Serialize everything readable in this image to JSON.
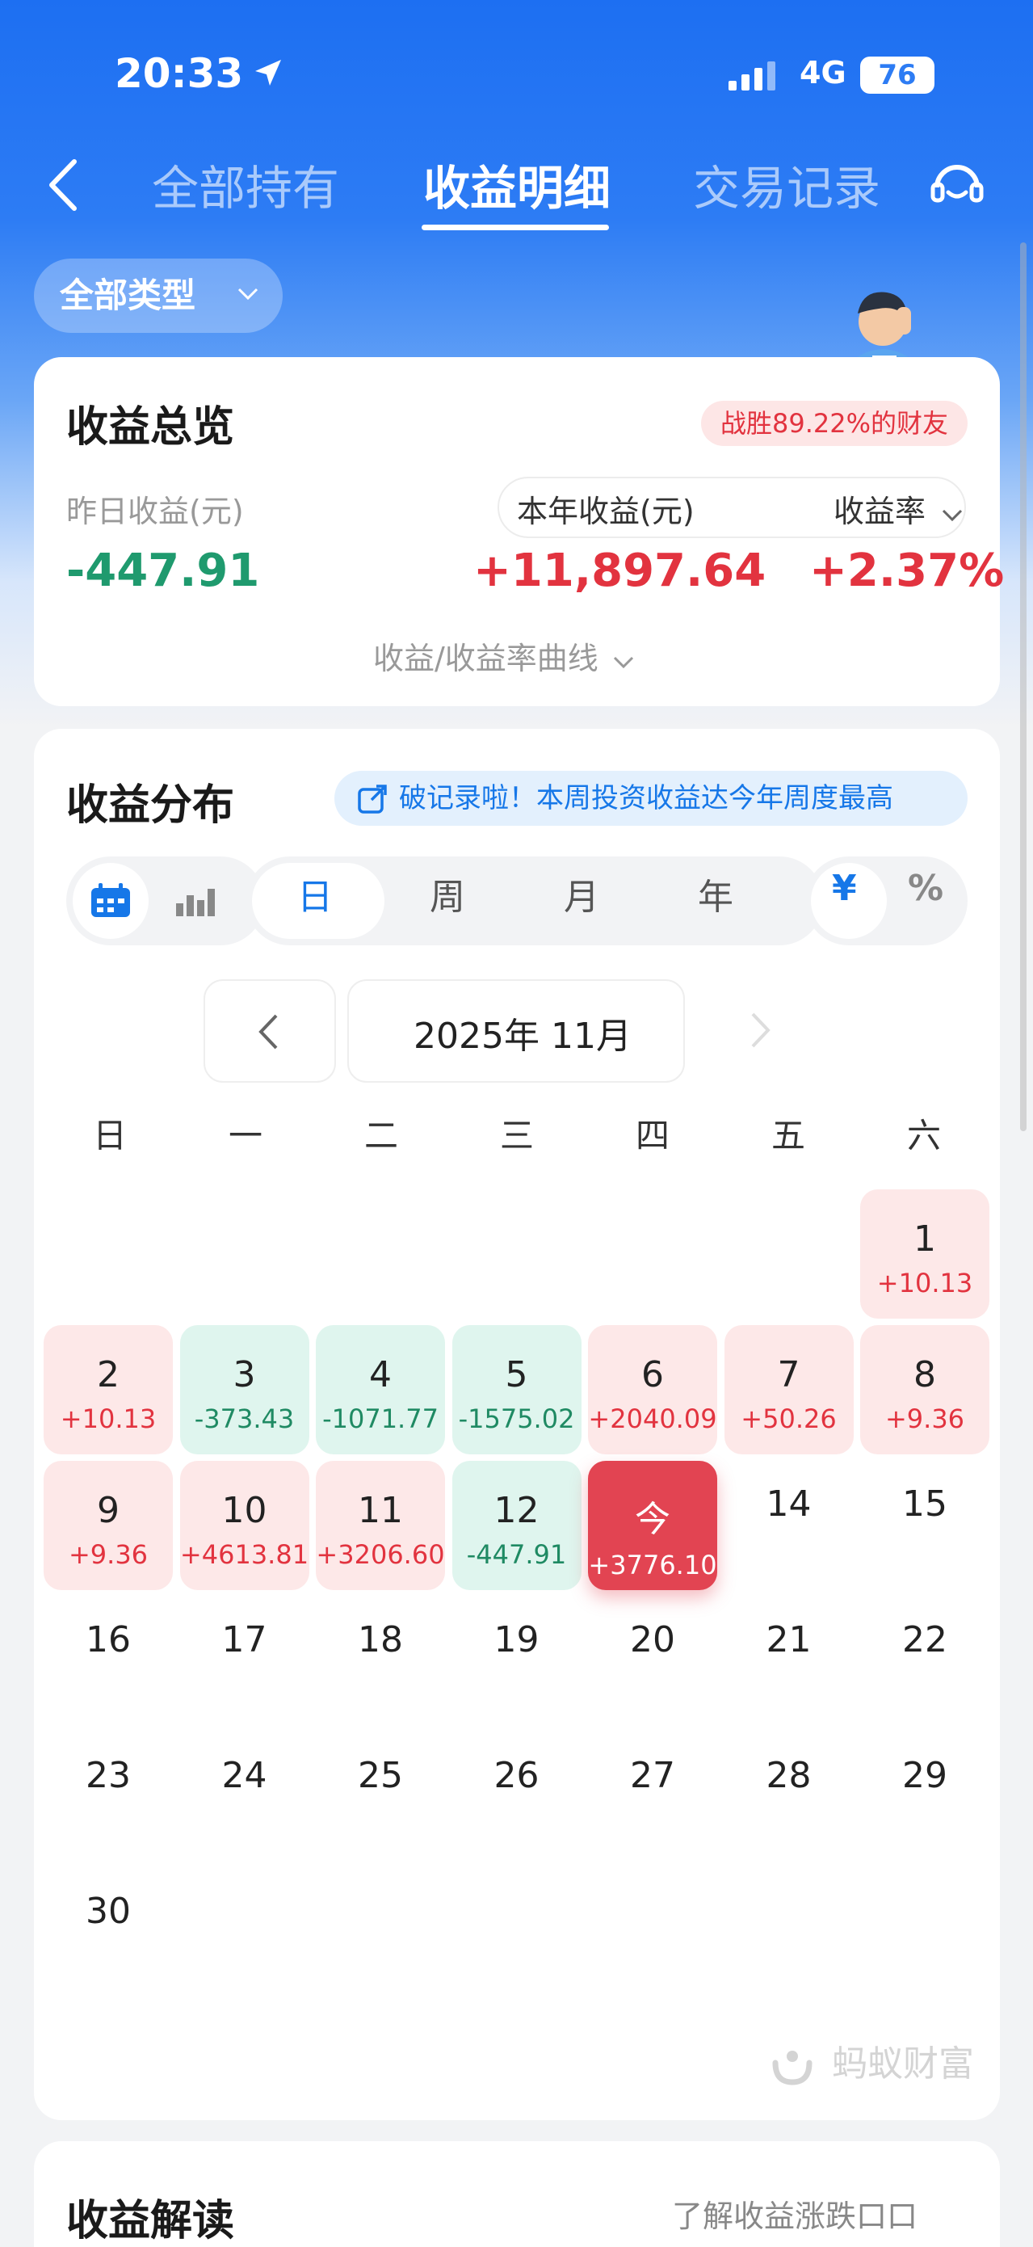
{
  "status_bar": {
    "time": "20:33",
    "network": "4G",
    "battery": "76"
  },
  "header": {
    "tabs": [
      {
        "label": "全部持有",
        "active": false
      },
      {
        "label": "收益明细",
        "active": true
      },
      {
        "label": "交易记录",
        "active": false
      }
    ]
  },
  "filter": {
    "type_label": "全部类型"
  },
  "overview": {
    "title": "收益总览",
    "rank_badge": "战胜89.22%的财友",
    "yesterday_label": "昨日收益(元)",
    "yesterday_value": "-447.91",
    "year_label": "本年收益(元)",
    "year_value": "+11,897.64",
    "rate_label": "收益率",
    "rate_value": "+2.37%",
    "curve_link": "收益/收益率曲线"
  },
  "distribution": {
    "title": "收益分布",
    "banner": "破记录啦！本周投资收益达今年周度最高",
    "periods": [
      "日",
      "周",
      "月",
      "年"
    ],
    "units": [
      "¥",
      "%"
    ],
    "month_label": "2025年 11月",
    "weekdays": [
      "日",
      "一",
      "二",
      "三",
      "四",
      "五",
      "六"
    ],
    "days": [
      {
        "day": "1",
        "value": "+10.13",
        "state": "pos"
      },
      {
        "day": "2",
        "value": "+10.13",
        "state": "pos"
      },
      {
        "day": "3",
        "value": "-373.43",
        "state": "neg"
      },
      {
        "day": "4",
        "value": "-1071.77",
        "state": "neg"
      },
      {
        "day": "5",
        "value": "-1575.02",
        "state": "neg"
      },
      {
        "day": "6",
        "value": "+2040.09",
        "state": "pos"
      },
      {
        "day": "7",
        "value": "+50.26",
        "state": "pos"
      },
      {
        "day": "8",
        "value": "+9.36",
        "state": "pos"
      },
      {
        "day": "9",
        "value": "+9.36",
        "state": "pos"
      },
      {
        "day": "10",
        "value": "+4613.81",
        "state": "pos"
      },
      {
        "day": "11",
        "value": "+3206.60",
        "state": "pos"
      },
      {
        "day": "12",
        "value": "-447.91",
        "state": "neg"
      },
      {
        "day": "今",
        "value": "+3776.10",
        "state": "today"
      },
      {
        "day": "14",
        "value": "",
        "state": "plain"
      },
      {
        "day": "15",
        "value": "",
        "state": "plain"
      },
      {
        "day": "16",
        "value": "",
        "state": "plain"
      },
      {
        "day": "17",
        "value": "",
        "state": "plain"
      },
      {
        "day": "18",
        "value": "",
        "state": "plain"
      },
      {
        "day": "19",
        "value": "",
        "state": "plain"
      },
      {
        "day": "20",
        "value": "",
        "state": "plain"
      },
      {
        "day": "21",
        "value": "",
        "state": "plain"
      },
      {
        "day": "22",
        "value": "",
        "state": "plain"
      },
      {
        "day": "23",
        "value": "",
        "state": "plain"
      },
      {
        "day": "24",
        "value": "",
        "state": "plain"
      },
      {
        "day": "25",
        "value": "",
        "state": "plain"
      },
      {
        "day": "26",
        "value": "",
        "state": "plain"
      },
      {
        "day": "27",
        "value": "",
        "state": "plain"
      },
      {
        "day": "28",
        "value": "",
        "state": "plain"
      },
      {
        "day": "29",
        "value": "",
        "state": "plain"
      },
      {
        "day": "30",
        "value": "",
        "state": "plain"
      }
    ],
    "watermark": "蚂蚁财富"
  },
  "interpretation": {
    "title": "收益解读",
    "link": "了解收益涨跌口口"
  }
}
